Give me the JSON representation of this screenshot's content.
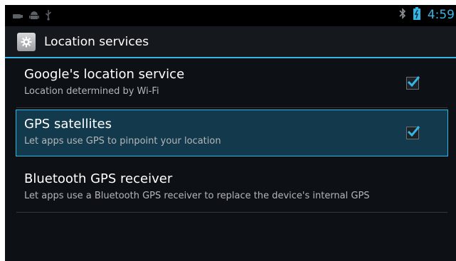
{
  "status_bar": {
    "time": "4:59",
    "icons": [
      "usb-icon",
      "android-debug-icon",
      "usb-tether-icon",
      "bluetooth-icon",
      "battery-icon"
    ]
  },
  "action_bar": {
    "title": "Location services",
    "icon": "settings-gear-icon"
  },
  "items": [
    {
      "title": "Google's location service",
      "summary": "Location determined by Wi-Fi",
      "checked": true,
      "selected": false
    },
    {
      "title": "GPS satellites",
      "summary": "Let apps use GPS to pinpoint your location",
      "checked": true,
      "selected": true
    },
    {
      "title": "Bluetooth GPS receiver",
      "summary": "Let apps use a Bluetooth GPS receiver to replace the device's internal GPS",
      "checked": false,
      "selected": false
    }
  ],
  "colors": {
    "accent": "#33b5e5",
    "background": "#0d1115",
    "selected_background": "#123a4c"
  }
}
